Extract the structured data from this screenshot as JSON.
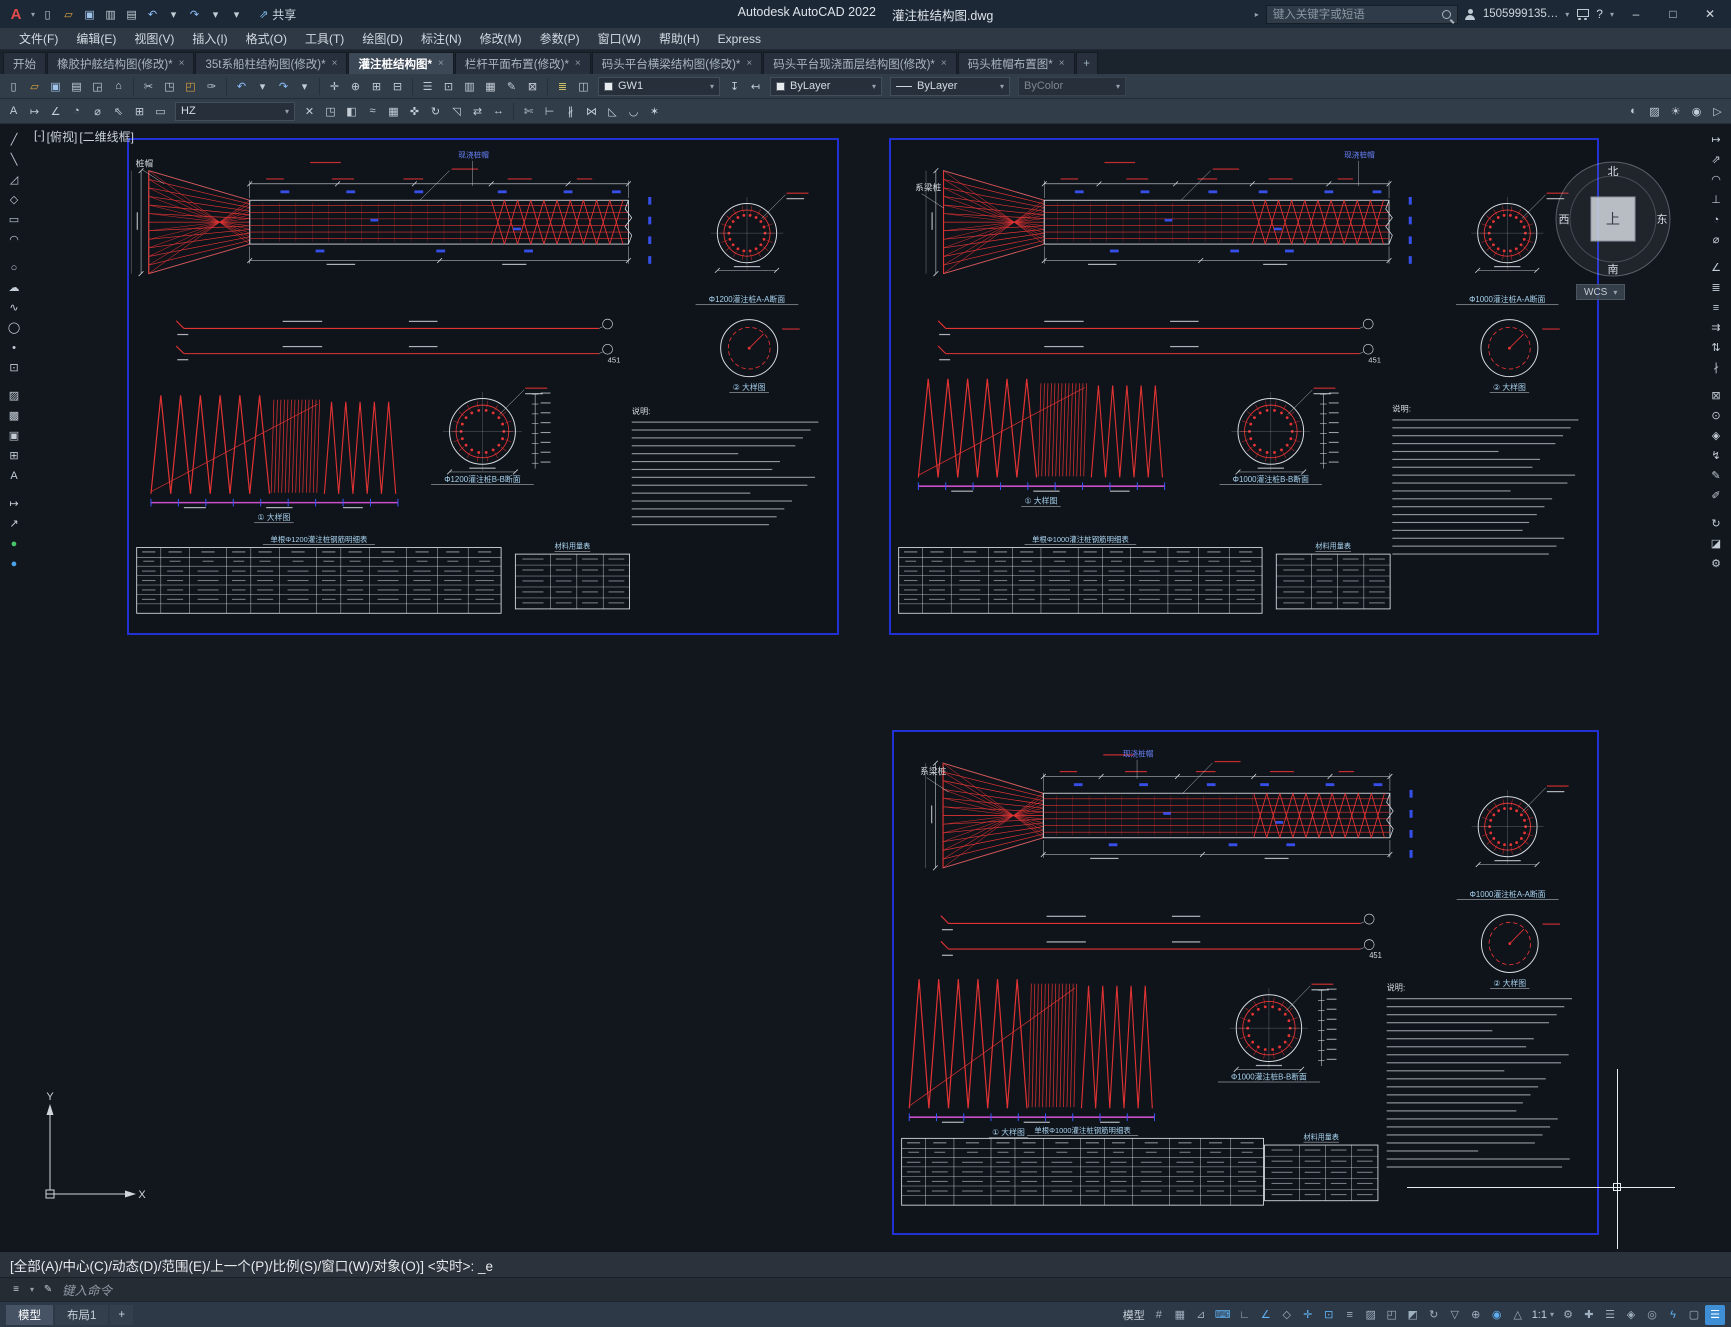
{
  "window": {
    "brand": "Autodesk AutoCAD 2022",
    "doc": "灌注桩结构图.dwg",
    "share": "共享",
    "search_placeholder": "键入关键字或短语",
    "account": "1505999135…",
    "help": "?",
    "minimize": "–",
    "maximize": "□",
    "close": "✕"
  },
  "quick_access": [
    {
      "name": "new-file-quick-icon",
      "glyph": "▯"
    },
    {
      "name": "open-file-quick-icon",
      "glyph": "▱",
      "color": "#d9a33c"
    },
    {
      "name": "save-quick-icon",
      "glyph": "▣",
      "color": "#9fc3e8"
    },
    {
      "name": "save-as-quick-icon",
      "glyph": "▥"
    },
    {
      "name": "plot-quick-icon",
      "glyph": "▤"
    },
    {
      "name": "undo-quick-icon",
      "glyph": "↶",
      "color": "#8fc3ff"
    },
    {
      "name": "undo-caret-icon",
      "glyph": "▾"
    },
    {
      "name": "redo-quick-icon",
      "glyph": "↷",
      "color": "#8fc3ff"
    },
    {
      "name": "redo-caret-icon",
      "glyph": "▾"
    },
    {
      "name": "quick-access-menu-caret-icon",
      "glyph": "▾"
    }
  ],
  "menubar": {
    "items": [
      {
        "name": "menu-file",
        "label": "文件(F)"
      },
      {
        "name": "menu-edit",
        "label": "编辑(E)"
      },
      {
        "name": "menu-view",
        "label": "视图(V)"
      },
      {
        "name": "menu-insert",
        "label": "插入(I)"
      },
      {
        "name": "menu-format",
        "label": "格式(O)"
      },
      {
        "name": "menu-tools",
        "label": "工具(T)"
      },
      {
        "name": "menu-draw",
        "label": "绘图(D)"
      },
      {
        "name": "menu-dimension",
        "label": "标注(N)"
      },
      {
        "name": "menu-modify",
        "label": "修改(M)"
      },
      {
        "name": "menu-parametric",
        "label": "参数(P)"
      },
      {
        "name": "menu-window",
        "label": "窗口(W)"
      },
      {
        "name": "menu-help",
        "label": "帮助(H)"
      },
      {
        "name": "menu-express",
        "label": "Express"
      }
    ]
  },
  "doc_tabs": [
    {
      "name": "tab-start",
      "label": "开始",
      "closable": false,
      "active": false
    },
    {
      "name": "tab-rubber-fender",
      "label": "橡胶护舷结构图(修改)*",
      "closable": true,
      "active": false
    },
    {
      "name": "tab-bollard",
      "label": "35t系船柱结构图(修改)*",
      "closable": true,
      "active": false
    },
    {
      "name": "tab-cast-pile",
      "label": "灌注桩结构图*",
      "closable": true,
      "active": true
    },
    {
      "name": "tab-railing",
      "label": "栏杆平面布置(修改)*",
      "closable": true,
      "active": false
    },
    {
      "name": "tab-beam",
      "label": "码头平台横梁结构图(修改)*",
      "closable": true,
      "active": false
    },
    {
      "name": "tab-deck",
      "label": "码头平台现浇面层结构图(修改)*",
      "closable": true,
      "active": false
    },
    {
      "name": "tab-pile-cap",
      "label": "码头桩帽布置图*",
      "closable": true,
      "active": false
    }
  ],
  "new_tab_glyph": "+",
  "toolbar1": {
    "groups": [
      [
        {
          "name": "new-file-icon",
          "glyph": "▯"
        },
        {
          "name": "open-file-icon",
          "glyph": "▱",
          "color": "#d9a33c"
        },
        {
          "name": "save-icon",
          "glyph": "▣",
          "color": "#9fc3e8"
        },
        {
          "name": "plot-icon",
          "glyph": "▤"
        },
        {
          "name": "plot-preview-icon",
          "glyph": "◲"
        },
        {
          "name": "publish-icon",
          "glyph": "⌂"
        }
      ],
      [
        {
          "name": "cut-icon",
          "glyph": "✂"
        },
        {
          "name": "copy-icon",
          "glyph": "◳"
        },
        {
          "name": "paste-icon",
          "glyph": "◰",
          "color": "#d9a33c"
        },
        {
          "name": "match-properties-icon",
          "glyph": "✑"
        }
      ],
      [
        {
          "name": "undo-icon",
          "glyph": "↶",
          "color": "#8fc3ff"
        },
        {
          "name": "undo-list-caret-icon",
          "glyph": "▾"
        },
        {
          "name": "redo-icon",
          "glyph": "↷",
          "color": "#8fc3ff"
        },
        {
          "name": "redo-list-caret-icon",
          "glyph": "▾"
        }
      ],
      [
        {
          "name": "pan-icon",
          "glyph": "✛"
        },
        {
          "name": "zoom-realtime-icon",
          "glyph": "⊕"
        },
        {
          "name": "zoom-window-icon",
          "glyph": "⊞"
        },
        {
          "name": "zoom-previous-icon",
          "glyph": "⊟"
        }
      ],
      [
        {
          "name": "properties-palette-icon",
          "glyph": "☰"
        },
        {
          "name": "design-center-icon",
          "glyph": "⊡"
        },
        {
          "name": "tool-palettes-icon",
          "glyph": "▥"
        },
        {
          "name": "sheet-set-manager-icon",
          "glyph": "▦"
        },
        {
          "name": "markup-icon",
          "glyph": "✎"
        },
        {
          "name": "quick-calc-icon",
          "glyph": "⊠"
        }
      ],
      [
        {
          "name": "layer-properties-icon",
          "glyph": "≣",
          "color": "#e0d06a"
        },
        {
          "name": "layer-tools-icon",
          "glyph": "◫"
        }
      ]
    ],
    "layer_value": "GW1",
    "post_layer_icons": [
      {
        "name": "make-object-layer-current-icon",
        "glyph": "↧"
      },
      {
        "name": "layer-previous-icon",
        "glyph": "↤"
      }
    ],
    "color_value": "ByLayer",
    "linetype_value": "ByLayer",
    "plotstyle_value": "ByColor"
  },
  "toolbar2": {
    "left_group": [
      {
        "name": "mtext-icon",
        "glyph": "A"
      },
      {
        "name": "dim-linear-icon",
        "glyph": "↦"
      },
      {
        "name": "dim-angular-icon",
        "glyph": "∠"
      },
      {
        "name": "dim-radius-icon",
        "glyph": "◔"
      },
      {
        "name": "dim-diameter-icon",
        "glyph": "⌀"
      },
      {
        "name": "multileader-icon",
        "glyph": "⇖"
      },
      {
        "name": "table-icon",
        "glyph": "⊞"
      },
      {
        "name": "field-icon",
        "glyph": "▭"
      }
    ],
    "style_value": "HZ",
    "mid_groups": [
      [
        {
          "name": "erase-icon",
          "glyph": "✕"
        },
        {
          "name": "copy-object-icon",
          "glyph": "◳"
        },
        {
          "name": "mirror-icon",
          "glyph": "◧"
        },
        {
          "name": "offset-icon",
          "glyph": "≈"
        },
        {
          "name": "array-icon",
          "glyph": "▦"
        },
        {
          "name": "move-icon",
          "glyph": "✜"
        },
        {
          "name": "rotate-icon",
          "glyph": "↻"
        },
        {
          "name": "scale-icon",
          "glyph": "◹"
        },
        {
          "name": "stretch-icon",
          "glyph": "⇄"
        },
        {
          "name": "lengthen-icon",
          "glyph": "↔"
        }
      ],
      [
        {
          "name": "trim-icon",
          "glyph": "✄"
        },
        {
          "name": "extend-icon",
          "glyph": "⊢"
        },
        {
          "name": "break-icon",
          "glyph": "∦"
        },
        {
          "name": "join-icon",
          "glyph": "⋈"
        },
        {
          "name": "chamfer-icon",
          "glyph": "◺"
        },
        {
          "name": "fillet-icon",
          "glyph": "◡"
        },
        {
          "name": "explode-icon",
          "glyph": "✶"
        }
      ]
    ],
    "right_group": [
      {
        "name": "render-icon",
        "glyph": "◐"
      },
      {
        "name": "materials-icon",
        "glyph": "▨"
      },
      {
        "name": "light-icon",
        "glyph": "☀"
      },
      {
        "name": "camera-icon",
        "glyph": "◉"
      },
      {
        "name": "walk-icon",
        "glyph": "▷"
      }
    ]
  },
  "left_toolbar": [
    [
      {
        "name": "line-tool-icon",
        "glyph": "╱"
      },
      {
        "name": "construction-line-tool-icon",
        "glyph": "╲"
      },
      {
        "name": "polyline-tool-icon",
        "glyph": "◿"
      },
      {
        "name": "polygon-tool-icon",
        "glyph": "◇"
      },
      {
        "name": "rectangle-tool-icon",
        "glyph": "▭"
      },
      {
        "name": "arc-tool-icon",
        "glyph": "◠"
      }
    ],
    [
      {
        "name": "circle-tool-icon",
        "glyph": "○"
      },
      {
        "name": "revision-cloud-tool-icon",
        "glyph": "☁"
      },
      {
        "name": "spline-tool-icon",
        "glyph": "∿"
      },
      {
        "name": "ellipse-tool-icon",
        "glyph": "◯"
      },
      {
        "name": "point-tool-icon",
        "glyph": "•"
      },
      {
        "name": "insert-block-tool-icon",
        "glyph": "⊡"
      }
    ],
    [
      {
        "name": "hatch-tool-icon",
        "glyph": "▨"
      },
      {
        "name": "gradient-tool-icon",
        "glyph": "▩"
      },
      {
        "name": "region-tool-icon",
        "glyph": "▣"
      },
      {
        "name": "table-tool-icon",
        "glyph": "⊞"
      },
      {
        "name": "mtext-tool-icon",
        "glyph": "A"
      }
    ],
    [
      {
        "name": "dimension-tool-icon",
        "glyph": "↦"
      },
      {
        "name": "leader-tool-icon",
        "glyph": "↗"
      },
      {
        "name": "snap-marker-icon",
        "glyph": "●",
        "color": "#46c46a"
      },
      {
        "name": "osnap-marker-icon",
        "glyph": "●",
        "color": "#4aa3e8"
      }
    ]
  ],
  "right_toolbar": [
    [
      {
        "name": "dim-linear2-icon",
        "glyph": "↦"
      },
      {
        "name": "dim-aligned-icon",
        "glyph": "⇗"
      },
      {
        "name": "dim-arc-icon",
        "glyph": "◠"
      },
      {
        "name": "dim-ordinate-icon",
        "glyph": "⊥"
      },
      {
        "name": "dim-radius2-icon",
        "glyph": "◔"
      },
      {
        "name": "dim-diameter2-icon",
        "glyph": "⌀"
      }
    ],
    [
      {
        "name": "dim-angular2-icon",
        "glyph": "∠"
      },
      {
        "name": "quick-dim-icon",
        "glyph": "≣"
      },
      {
        "name": "baseline-dim-icon",
        "glyph": "≡"
      },
      {
        "name": "continue-dim-icon",
        "glyph": "⇉"
      },
      {
        "name": "dim-space-icon",
        "glyph": "⇅"
      },
      {
        "name": "dim-break-icon",
        "glyph": "∤"
      }
    ],
    [
      {
        "name": "tolerance-icon",
        "glyph": "⊠"
      },
      {
        "name": "center-mark-icon",
        "glyph": "⊙"
      },
      {
        "name": "inspection-icon",
        "glyph": "◈"
      },
      {
        "name": "jogged-dim-icon",
        "glyph": "↯"
      },
      {
        "name": "dim-edit-icon",
        "glyph": "✎"
      },
      {
        "name": "dim-text-edit-icon",
        "glyph": "✐"
      }
    ],
    [
      {
        "name": "dim-update-icon",
        "glyph": "↻"
      },
      {
        "name": "dim-style-icon",
        "glyph": "◪"
      },
      {
        "name": "dim-settings-icon",
        "glyph": "⚙"
      }
    ]
  ],
  "canvas": {
    "vp_controls": "[-]",
    "vp_view": "[俯视]",
    "vp_visual": "[二维线框]",
    "compass": {
      "north": "北",
      "south": "南",
      "west": "西",
      "east": "东",
      "top": "上",
      "wcs": "WCS"
    },
    "ucs": {
      "x": "X",
      "y": "Y"
    }
  },
  "sheets": [
    {
      "beam_label": "桩帽",
      "cap_label": "现浇桩帽",
      "section_a_label": "Φ1200灌注桩A-A断面",
      "section_b_label": "Φ1200灌注桩B-B断面",
      "detail1_label": "① 大样图",
      "detail2_label": "② 大样图",
      "dim_right": "451",
      "notes_title": "说明:",
      "rebar_table_caption": "单根Φ1200灌注桩钢筋明细表",
      "material_table_caption": "材料用量表"
    },
    {
      "beam_label": "系梁桩",
      "cap_label": "现浇桩帽",
      "section_a_label": "Φ1000灌注桩A-A断面",
      "section_b_label": "Φ1000灌注桩B-B断面",
      "detail1_label": "① 大样图",
      "detail2_label": "② 大样图",
      "dim_right": "451",
      "notes_title": "说明:",
      "rebar_table_caption": "单根Φ1000灌注桩钢筋明细表",
      "material_table_caption": "材料用量表"
    },
    {
      "beam_label": "系梁桩",
      "cap_label": "现浇桩帽",
      "section_a_label": "Φ1000灌注桩A-A断面",
      "section_b_label": "Φ1000灌注桩B-B断面",
      "detail1_label": "① 大样图",
      "detail2_label": "② 大样图",
      "dim_right": "451",
      "notes_title": "说明:",
      "rebar_table_caption": "单根Φ1000灌注桩钢筋明细表",
      "material_table_caption": "材料用量表"
    }
  ],
  "command": {
    "prompt": "[全部(A)/中心(C)/动态(D)/范围(E)/上一个(P)/比例(S)/窗口(W)/对象(O)] <实时>: _e",
    "placeholder": "键入命令"
  },
  "statusbar": {
    "model_tab": "模型",
    "layout_tab": "布局1",
    "add_layout": "+",
    "scale": "1:1",
    "right": [
      {
        "name": "model-space-button",
        "label": "模型"
      },
      {
        "name": "grid-display-toggle",
        "glyph": "#"
      },
      {
        "name": "snap-mode-toggle",
        "glyph": "▦"
      },
      {
        "name": "infer-constraints-toggle",
        "glyph": "⊿"
      },
      {
        "name": "dynamic-input-toggle",
        "glyph": "⌨",
        "active": true
      },
      {
        "name": "ortho-mode-toggle",
        "glyph": "∟"
      },
      {
        "name": "polar-tracking-toggle",
        "glyph": "∠",
        "active": true
      },
      {
        "name": "isodraft-toggle",
        "glyph": "◇"
      },
      {
        "name": "object-snap-tracking-toggle",
        "glyph": "✛",
        "active": true
      },
      {
        "name": "object-snap-toggle",
        "glyph": "⊡",
        "active": true
      },
      {
        "name": "lineweight-toggle",
        "glyph": "≡"
      },
      {
        "name": "transparency-toggle",
        "glyph": "▨"
      },
      {
        "name": "selection-cycling-toggle",
        "glyph": "◰"
      },
      {
        "name": "3d-osnap-toggle",
        "glyph": "◩"
      },
      {
        "name": "dynamic-ucs-toggle",
        "glyph": "↻"
      },
      {
        "name": "selection-filtering-toggle",
        "glyph": "▽"
      },
      {
        "name": "gizmo-toggle",
        "glyph": "⊕"
      },
      {
        "name": "annotation-visibility-toggle",
        "glyph": "◉",
        "active": true
      },
      {
        "name": "autoscale-toggle",
        "glyph": "△"
      },
      {
        "name": "annotation-scale-button",
        "label": "1:1",
        "caret": true
      },
      {
        "name": "workspace-switching-button",
        "glyph": "⚙"
      },
      {
        "name": "annotation-monitor-toggle",
        "glyph": "✚"
      },
      {
        "name": "quick-properties-toggle",
        "glyph": "☰"
      },
      {
        "name": "lock-ui-button",
        "glyph": "◈"
      },
      {
        "name": "isolate-objects-button",
        "glyph": "◎"
      },
      {
        "name": "graphics-performance-toggle",
        "glyph": "ϟ",
        "active": true
      },
      {
        "name": "clean-screen-button",
        "glyph": "▢"
      },
      {
        "name": "customization-button",
        "glyph": "☰",
        "blue": true
      }
    ]
  }
}
